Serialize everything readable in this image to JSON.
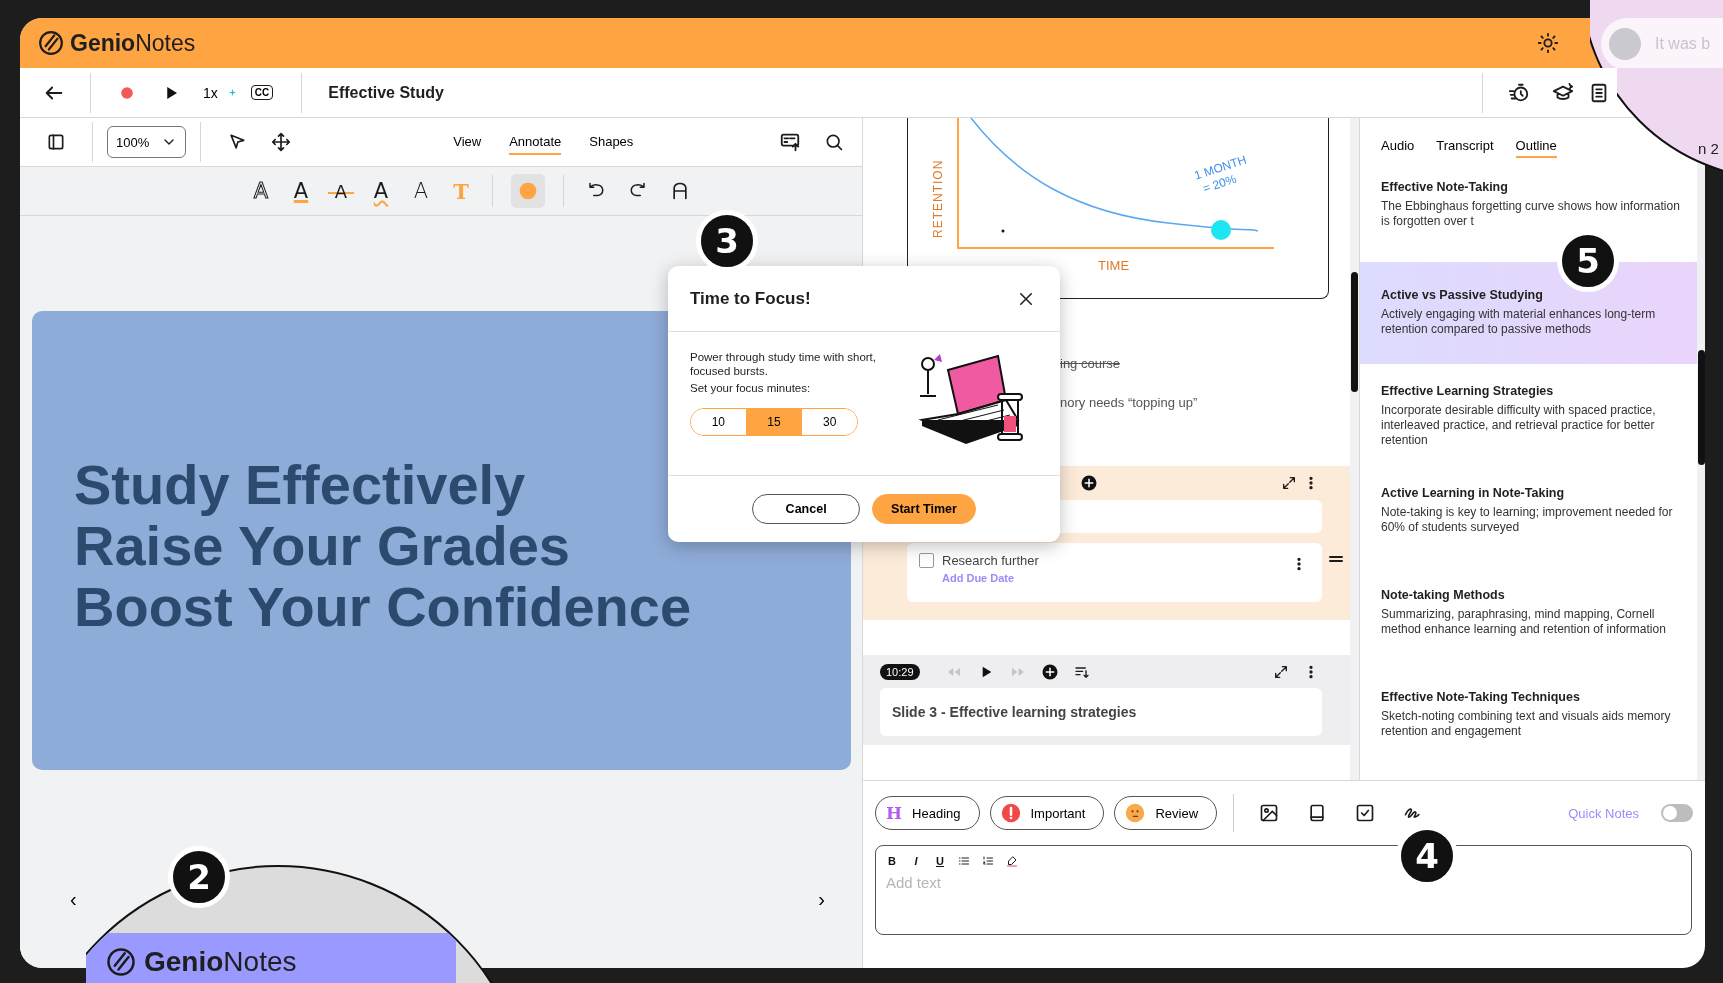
{
  "app": {
    "name": "**Genio**Notes"
  },
  "top_bar": {
    "speed": "1x",
    "captions": "CC",
    "title": "Effective Study"
  },
  "left_toolbar": {
    "zoom": "100%",
    "tabs": [
      {
        "label": "View",
        "selected": false
      },
      {
        "label": "Annotate",
        "selected": true
      },
      {
        "label": "Shapes",
        "selected": false
      }
    ]
  },
  "text_styles": [
    {
      "glyph": "A",
      "kind": "outline"
    },
    {
      "glyph": "A",
      "kind": "underline"
    },
    {
      "glyph": "A",
      "kind": "strike"
    },
    {
      "glyph": "A",
      "kind": "wavy"
    },
    {
      "glyph": "A",
      "kind": "thin"
    },
    {
      "glyph": "T",
      "kind": "bold"
    }
  ],
  "slide": {
    "lines": [
      "Study Effectively",
      "Raise Your Grades",
      "Boost Your Confidence"
    ]
  },
  "slide_nav": {
    "previous": "‹",
    "next": "›"
  },
  "sketch": {
    "ylabel": "RETENTION",
    "xlabel": "TIME",
    "note_lines": [
      "1 MONTH",
      "= 20%"
    ]
  },
  "notes": [
    {
      "text": "ing course",
      "struck": true
    },
    {
      "text": "nory needs “topping up”",
      "struck": false
    }
  ],
  "tasks": [
    {
      "text": "Research further",
      "checked": false,
      "link": "Add Due Date"
    }
  ],
  "slide_block": {
    "time": "10:29",
    "title": "Slide 3 - Effective learning strategies"
  },
  "outline": {
    "tabs": [
      {
        "label": "Audio",
        "selected": false
      },
      {
        "label": "Transcript",
        "selected": false
      },
      {
        "label": "Outline",
        "selected": true
      }
    ],
    "items": [
      {
        "title": "Effective Note-Taking",
        "summary": "The Ebbinghaus forgetting curve shows how information is forgotten over t",
        "selected": false
      },
      {
        "title": "Active vs Passive Studying",
        "summary": "Actively engaging with material enhances long-term retention compared to passive methods",
        "selected": true
      },
      {
        "title": "Effective Learning Strategies",
        "summary": "Incorporate desirable difficulty with spaced practice, interleaved practice, and retrieval practice for better retention",
        "selected": false
      },
      {
        "title": "Active Learning in Note-Taking",
        "summary": "Note-taking is key to learning; improvement needed for 60% of students surveyed",
        "selected": false
      },
      {
        "title": "Note-taking Methods",
        "summary": "Summarizing, paraphrasing, mind mapping, Cornell method enhance learning and retention of information",
        "selected": false
      },
      {
        "title": "Effective Note-Taking Techniques",
        "summary": "Sketch-noting combining text and visuals aids memory retention and engagement",
        "selected": false
      }
    ]
  },
  "editor": {
    "tags": [
      {
        "kind": "heading",
        "icon": "H",
        "label": "Heading"
      },
      {
        "kind": "important",
        "label": "Important"
      },
      {
        "kind": "review",
        "label": "Review"
      }
    ],
    "quick_notes": {
      "label": "Quick Notes",
      "on": false
    },
    "format": [
      {
        "glyph": "B",
        "kind": "bold"
      },
      {
        "glyph": "I",
        "kind": "italic"
      },
      {
        "glyph": "U",
        "kind": "underline"
      }
    ],
    "placeholder": "Add text"
  },
  "dialog": {
    "title": "Time to Focus!",
    "message": "Power through study time with short, focused bursts.",
    "prompt": "Set your focus minutes:",
    "options": [
      {
        "label": "10",
        "selected": false
      },
      {
        "label": "15",
        "selected": true
      },
      {
        "label": "30",
        "selected": false
      }
    ],
    "buttons": [
      {
        "label": "Cancel",
        "kind": "secondary"
      },
      {
        "label": "Start Timer",
        "kind": "primary"
      }
    ]
  },
  "callouts": [
    "3",
    "5",
    "4",
    "2"
  ],
  "magnifier_top": {
    "placeholder": "It was b",
    "label": "n 2"
  },
  "magnifier_bottom": {
    "app_name": "**Genio**Notes"
  }
}
